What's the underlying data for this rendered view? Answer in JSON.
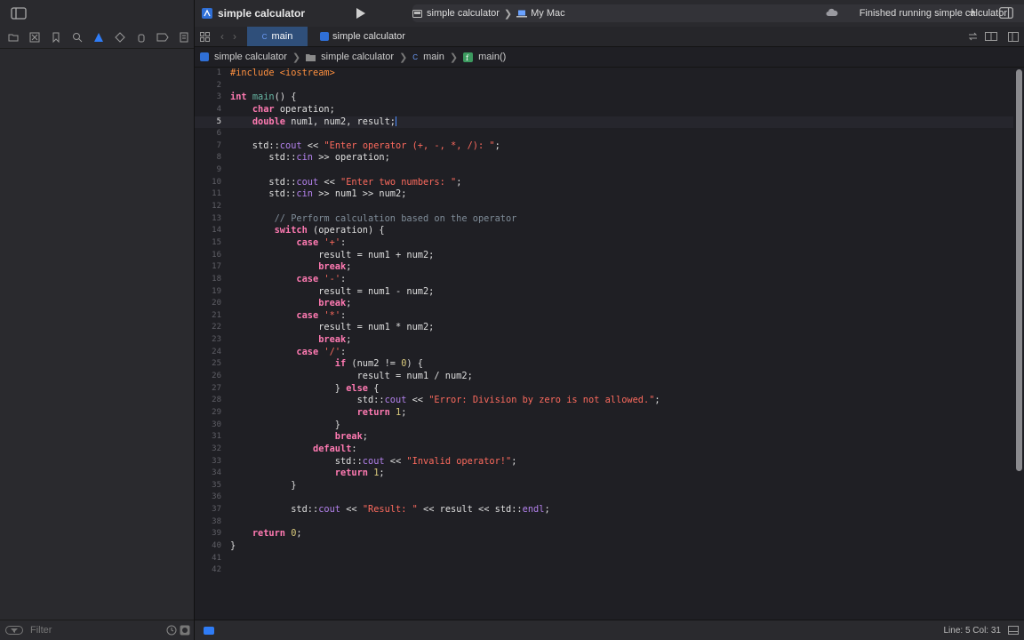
{
  "window": {
    "project_title": "simple calculator"
  },
  "toolbar": {
    "scheme_name": "simple calculator",
    "destination": "My Mac",
    "status": "Finished running simple calculator",
    "add_symbol": "+"
  },
  "tabs": [
    {
      "label": "main",
      "active": true
    },
    {
      "label": "simple calculator",
      "active": false
    }
  ],
  "breadcrumb": [
    "simple calculator",
    "simple calculator",
    "main",
    "main()"
  ],
  "sidebar": {
    "filter_placeholder": "Filter"
  },
  "code_lines": [
    [
      [
        "pp",
        "#include <iostream>"
      ]
    ],
    [],
    [
      [
        "kw",
        "int"
      ],
      [
        "code",
        " "
      ],
      [
        "fn",
        "main"
      ],
      [
        "code",
        "() {"
      ]
    ],
    [
      [
        "code",
        "    "
      ],
      [
        "kw",
        "char"
      ],
      [
        "code",
        " operation;"
      ]
    ],
    [
      [
        "code",
        "    "
      ],
      [
        "kw",
        "double"
      ],
      [
        "code",
        " num1, num2, result;"
      ]
    ],
    [],
    [
      [
        "code",
        "    std::"
      ],
      [
        "lib",
        "cout"
      ],
      [
        "code",
        " << "
      ],
      [
        "str",
        "\"Enter operator (+, -, *, /): \""
      ],
      [
        "code",
        ";"
      ]
    ],
    [
      [
        "code",
        "       std::"
      ],
      [
        "lib",
        "cin"
      ],
      [
        "code",
        " >> operation;"
      ]
    ],
    [],
    [
      [
        "code",
        "       std::"
      ],
      [
        "lib",
        "cout"
      ],
      [
        "code",
        " << "
      ],
      [
        "str",
        "\"Enter two numbers: \""
      ],
      [
        "code",
        ";"
      ]
    ],
    [
      [
        "code",
        "       std::"
      ],
      [
        "lib",
        "cin"
      ],
      [
        "code",
        " >> num1 >> num2;"
      ]
    ],
    [],
    [
      [
        "code",
        "        "
      ],
      [
        "cm",
        "// Perform calculation based on the operator"
      ]
    ],
    [
      [
        "code",
        "        "
      ],
      [
        "kw",
        "switch"
      ],
      [
        "code",
        " (operation) {"
      ]
    ],
    [
      [
        "code",
        "            "
      ],
      [
        "kw",
        "case"
      ],
      [
        "code",
        " "
      ],
      [
        "str",
        "'+'"
      ],
      [
        "code",
        ":"
      ]
    ],
    [
      [
        "code",
        "                result = num1 + num2;"
      ]
    ],
    [
      [
        "code",
        "                "
      ],
      [
        "kw",
        "break"
      ],
      [
        "code",
        ";"
      ]
    ],
    [
      [
        "code",
        "            "
      ],
      [
        "kw",
        "case"
      ],
      [
        "code",
        " "
      ],
      [
        "str",
        "'-'"
      ],
      [
        "code",
        ":"
      ]
    ],
    [
      [
        "code",
        "                result = num1 - num2;"
      ]
    ],
    [
      [
        "code",
        "                "
      ],
      [
        "kw",
        "break"
      ],
      [
        "code",
        ";"
      ]
    ],
    [
      [
        "code",
        "            "
      ],
      [
        "kw",
        "case"
      ],
      [
        "code",
        " "
      ],
      [
        "str",
        "'*'"
      ],
      [
        "code",
        ":"
      ]
    ],
    [
      [
        "code",
        "                result = num1 * num2;"
      ]
    ],
    [
      [
        "code",
        "                "
      ],
      [
        "kw",
        "break"
      ],
      [
        "code",
        ";"
      ]
    ],
    [
      [
        "code",
        "            "
      ],
      [
        "kw",
        "case"
      ],
      [
        "code",
        " "
      ],
      [
        "str",
        "'/'"
      ],
      [
        "code",
        ":"
      ]
    ],
    [
      [
        "code",
        "                   "
      ],
      [
        "kw",
        "if"
      ],
      [
        "code",
        " (num2 != "
      ],
      [
        "num",
        "0"
      ],
      [
        "code",
        ") {"
      ]
    ],
    [
      [
        "code",
        "                       result = num1 / num2;"
      ]
    ],
    [
      [
        "code",
        "                   } "
      ],
      [
        "kw",
        "else"
      ],
      [
        "code",
        " {"
      ]
    ],
    [
      [
        "code",
        "                       std::"
      ],
      [
        "lib",
        "cout"
      ],
      [
        "code",
        " << "
      ],
      [
        "str",
        "\"Error: Division by zero is not allowed.\""
      ],
      [
        "code",
        ";"
      ]
    ],
    [
      [
        "code",
        "                       "
      ],
      [
        "kw",
        "return"
      ],
      [
        "code",
        " "
      ],
      [
        "num",
        "1"
      ],
      [
        "code",
        ";"
      ]
    ],
    [
      [
        "code",
        "                   }"
      ]
    ],
    [
      [
        "code",
        "                   "
      ],
      [
        "kw",
        "break"
      ],
      [
        "code",
        ";"
      ]
    ],
    [
      [
        "code",
        "               "
      ],
      [
        "kw",
        "default"
      ],
      [
        "code",
        ":"
      ]
    ],
    [
      [
        "code",
        "                   std::"
      ],
      [
        "lib",
        "cout"
      ],
      [
        "code",
        " << "
      ],
      [
        "str",
        "\"Invalid operator!\""
      ],
      [
        "code",
        ";"
      ]
    ],
    [
      [
        "code",
        "                   "
      ],
      [
        "kw",
        "return"
      ],
      [
        "code",
        " "
      ],
      [
        "num",
        "1"
      ],
      [
        "code",
        ";"
      ]
    ],
    [
      [
        "code",
        "           }"
      ]
    ],
    [],
    [
      [
        "code",
        "           std::"
      ],
      [
        "lib",
        "cout"
      ],
      [
        "code",
        " << "
      ],
      [
        "str",
        "\"Result: \""
      ],
      [
        "code",
        " << result << std::"
      ],
      [
        "lib",
        "endl"
      ],
      [
        "code",
        ";"
      ]
    ],
    [],
    [
      [
        "code",
        "    "
      ],
      [
        "kw",
        "return"
      ],
      [
        "code",
        " "
      ],
      [
        "num",
        "0"
      ],
      [
        "code",
        ";"
      ]
    ],
    [
      [
        "code",
        "}"
      ]
    ],
    [],
    []
  ],
  "cursor_line": 5,
  "status_bar": {
    "position": "Line: 5  Col: 31"
  }
}
